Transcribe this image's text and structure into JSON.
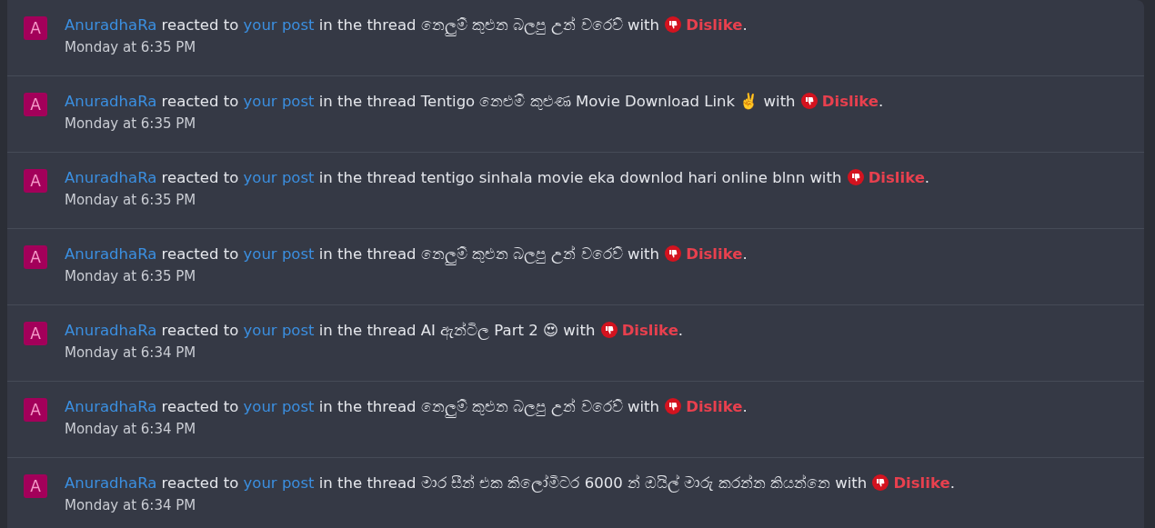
{
  "alerts": [
    {
      "avatar": "A",
      "user": "AnuradhaRa",
      "verb": "reacted to",
      "target": "your post",
      "context": "in the thread නෙලුම් කුළුන බලපු උන් වරෙව් with",
      "reaction": "Dislike",
      "end": ".",
      "time": "Monday at 6:35 PM"
    },
    {
      "avatar": "A",
      "user": "AnuradhaRa",
      "verb": "reacted to",
      "target": "your post",
      "context": "in the thread Tentigo නෙළුම් කුළුණ Movie Download Link ✌️ with",
      "reaction": "Dislike",
      "end": ".",
      "time": "Monday at 6:35 PM"
    },
    {
      "avatar": "A",
      "user": "AnuradhaRa",
      "verb": "reacted to",
      "target": "your post",
      "context": "in the thread tentigo sinhala movie eka downlod hari online blnn with",
      "reaction": "Dislike",
      "end": ".",
      "time": "Monday at 6:35 PM"
    },
    {
      "avatar": "A",
      "user": "AnuradhaRa",
      "verb": "reacted to",
      "target": "your post",
      "context": "in the thread නෙලුම් කුළුන බලපු උන් වරෙව් with",
      "reaction": "Dislike",
      "end": ".",
      "time": "Monday at 6:35 PM"
    },
    {
      "avatar": "A",
      "user": "AnuradhaRa",
      "verb": "reacted to",
      "target": "your post",
      "context": "in the thread AI ඇන්ටිල Part 2 😍 with",
      "reaction": "Dislike",
      "end": ".",
      "time": "Monday at 6:34 PM"
    },
    {
      "avatar": "A",
      "user": "AnuradhaRa",
      "verb": "reacted to",
      "target": "your post",
      "context": "in the thread නෙලුම් කුළුන බලපු උන් වරෙව් with",
      "reaction": "Dislike",
      "end": ".",
      "time": "Monday at 6:34 PM"
    },
    {
      "avatar": "A",
      "user": "AnuradhaRa",
      "verb": "reacted to",
      "target": "your post",
      "context": "in the thread මාර සීන් එක කිලෝමීටර 6000 න් ඔයිල් මාරු කරන්න කියන්නෙ with",
      "reaction": "Dislike",
      "end": ".",
      "time": "Monday at 6:34 PM"
    }
  ]
}
